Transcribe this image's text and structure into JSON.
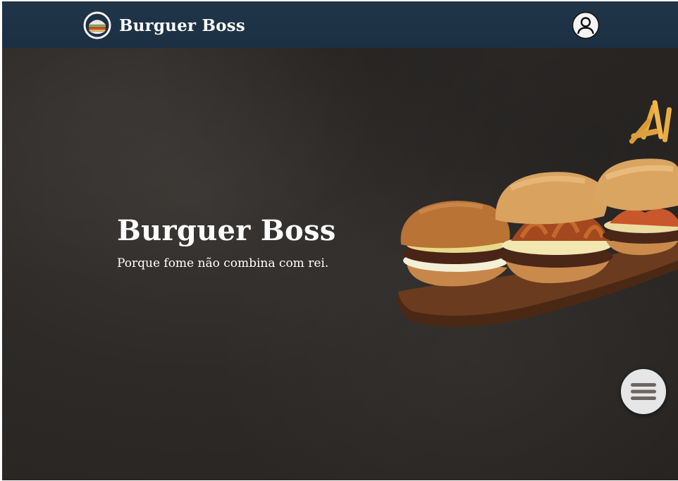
{
  "header": {
    "brand_name": "Burguer Boss",
    "logo_icon": "burger-logo-icon",
    "profile_icon": "user-circle-icon"
  },
  "hero": {
    "title": "Burguer Boss",
    "subtitle": "Porque fome não combina com rei."
  },
  "fab": {
    "icon": "hamburger-menu-icon"
  },
  "colors": {
    "navbar": "#1c3043",
    "background": "#2d2a28",
    "text": "#ffffff",
    "fab": "#e6e6e6"
  }
}
